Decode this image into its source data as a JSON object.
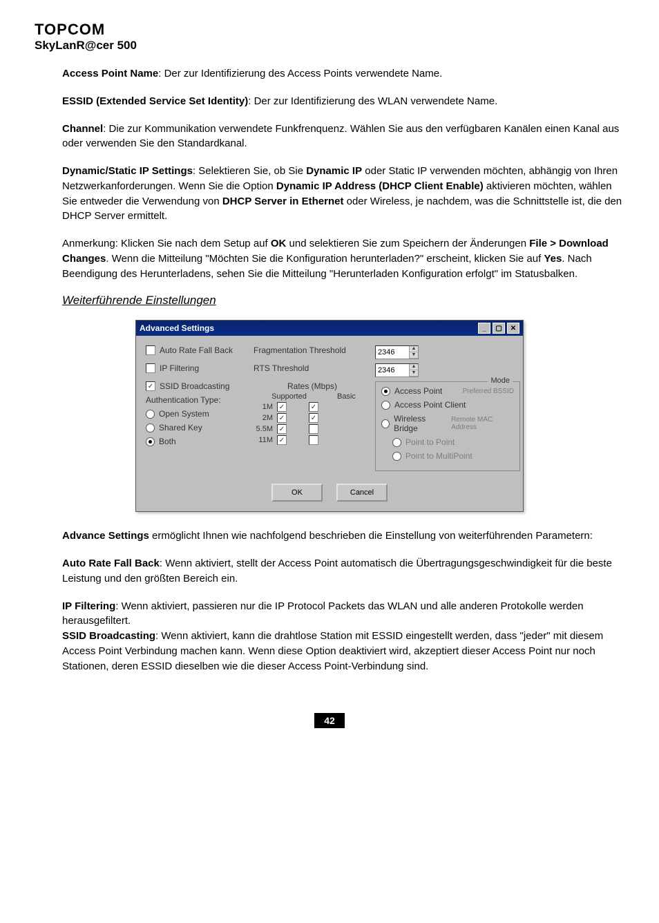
{
  "header": {
    "brand": "TOPCOM",
    "product": "SkyLanR@cer 500"
  },
  "p1": {
    "lead": "Access Point Name",
    "rest": ": Der zur Identifizierung des Access Points verwendete Name."
  },
  "p2": {
    "lead": "ESSID (Extended Service Set Identity)",
    "rest": ": Der zur Identifizierung des WLAN verwendete Name."
  },
  "p3": {
    "lead": "Channel",
    "rest": ": Die zur Kommunikation verwendete Funkfrenquenz. Wählen Sie aus den verfügbaren Kanälen einen Kanal aus oder verwenden Sie den Standardkanal."
  },
  "p4": {
    "lead": "Dynamic/Static IP Settings",
    "mid1": ": Selektieren Sie, ob Sie ",
    "bold1": "Dynamic IP",
    "mid2": " oder Static IP verwenden möchten, abhängig von Ihren Netzwerkanforderungen. Wenn Sie die Option ",
    "bold2": "Dynamic IP Address (DHCP Client Enable)",
    "mid3": " aktivieren möchten, wählen Sie entweder die Verwendung von ",
    "bold3": "DHCP Server in Ethernet",
    "mid4": " oder Wireless, je nachdem, was die Schnittstelle ist, die den DHCP Server ermittelt."
  },
  "p5": {
    "t1": "Anmerkung: Klicken Sie nach dem Setup auf ",
    "b1": "OK",
    "t2": " und selektieren Sie zum Speichern der Änderungen ",
    "b2": "File > Download Changes",
    "t3": ". Wenn die Mitteilung \"Möchten Sie die Konfiguration herunterladen?\" erscheint, klicken Sie auf ",
    "b3": "Yes",
    "t4": ". Nach Beendigung des Herunterladens, sehen Sie die Mitteilung \"Herunterladen Konfiguration erfolgt\" im Statusbalken."
  },
  "section_title": "Weiterführende Einstellungen ",
  "win": {
    "title": "Advanced Settings",
    "auto_rate": "Auto Rate Fall Back",
    "frag": "Fragmentation Threshold",
    "frag_val": "2346",
    "ip_filtering": "IP Filtering",
    "rts": "RTS Threshold",
    "rts_val": "2346",
    "ssid_broadcast": "SSID Broadcasting",
    "auth_type": "Authentication Type:",
    "open_system": "Open System",
    "shared_key": "Shared Key",
    "both": "Both",
    "rates_head": "Rates (Mbps)",
    "supported": "Supported",
    "basic": "Basic",
    "r1": "1M",
    "r2": "2M",
    "r5": "5.5M",
    "r11": "11M",
    "mode_legend": "Mode",
    "ap": "Access Point",
    "apc": "Access Point Client",
    "wb": "Wireless Bridge",
    "p2p": "Point to Point",
    "pmp": "Point to MultiPoint",
    "pref_bssid": "Preferred BSSID",
    "remote_mac": "Remote MAC Address",
    "ok": "OK",
    "cancel": "Cancel"
  },
  "p6": {
    "lead": "Advance Settings",
    "rest": " ermöglicht Ihnen wie nachfolgend beschrieben die Einstellung von weiterführenden Parametern:"
  },
  "p7": {
    "lead": "Auto Rate Fall Back",
    "rest": ": Wenn aktiviert, stellt der Access Point automatisch die Übertragungsgeschwindigkeit für die beste Leistung und den größten Bereich ein."
  },
  "p8": {
    "lead1": "IP Filtering",
    "t1": ": Wenn aktiviert, passieren nur die IP Protocol Packets das WLAN und alle anderen Protokolle werden herausgefiltert.",
    "lead2": "SSID Broadcasting",
    "t2": ": Wenn aktiviert, kann die drahtlose Station mit ESSID eingestellt werden, dass \"jeder\" mit diesem Access Point Verbindung machen kann. Wenn diese Option deaktiviert wird, akzeptiert dieser Access Point nur noch Stationen, deren ESSID dieselben wie die dieser Access Point-Verbindung sind."
  },
  "page_number": "42"
}
